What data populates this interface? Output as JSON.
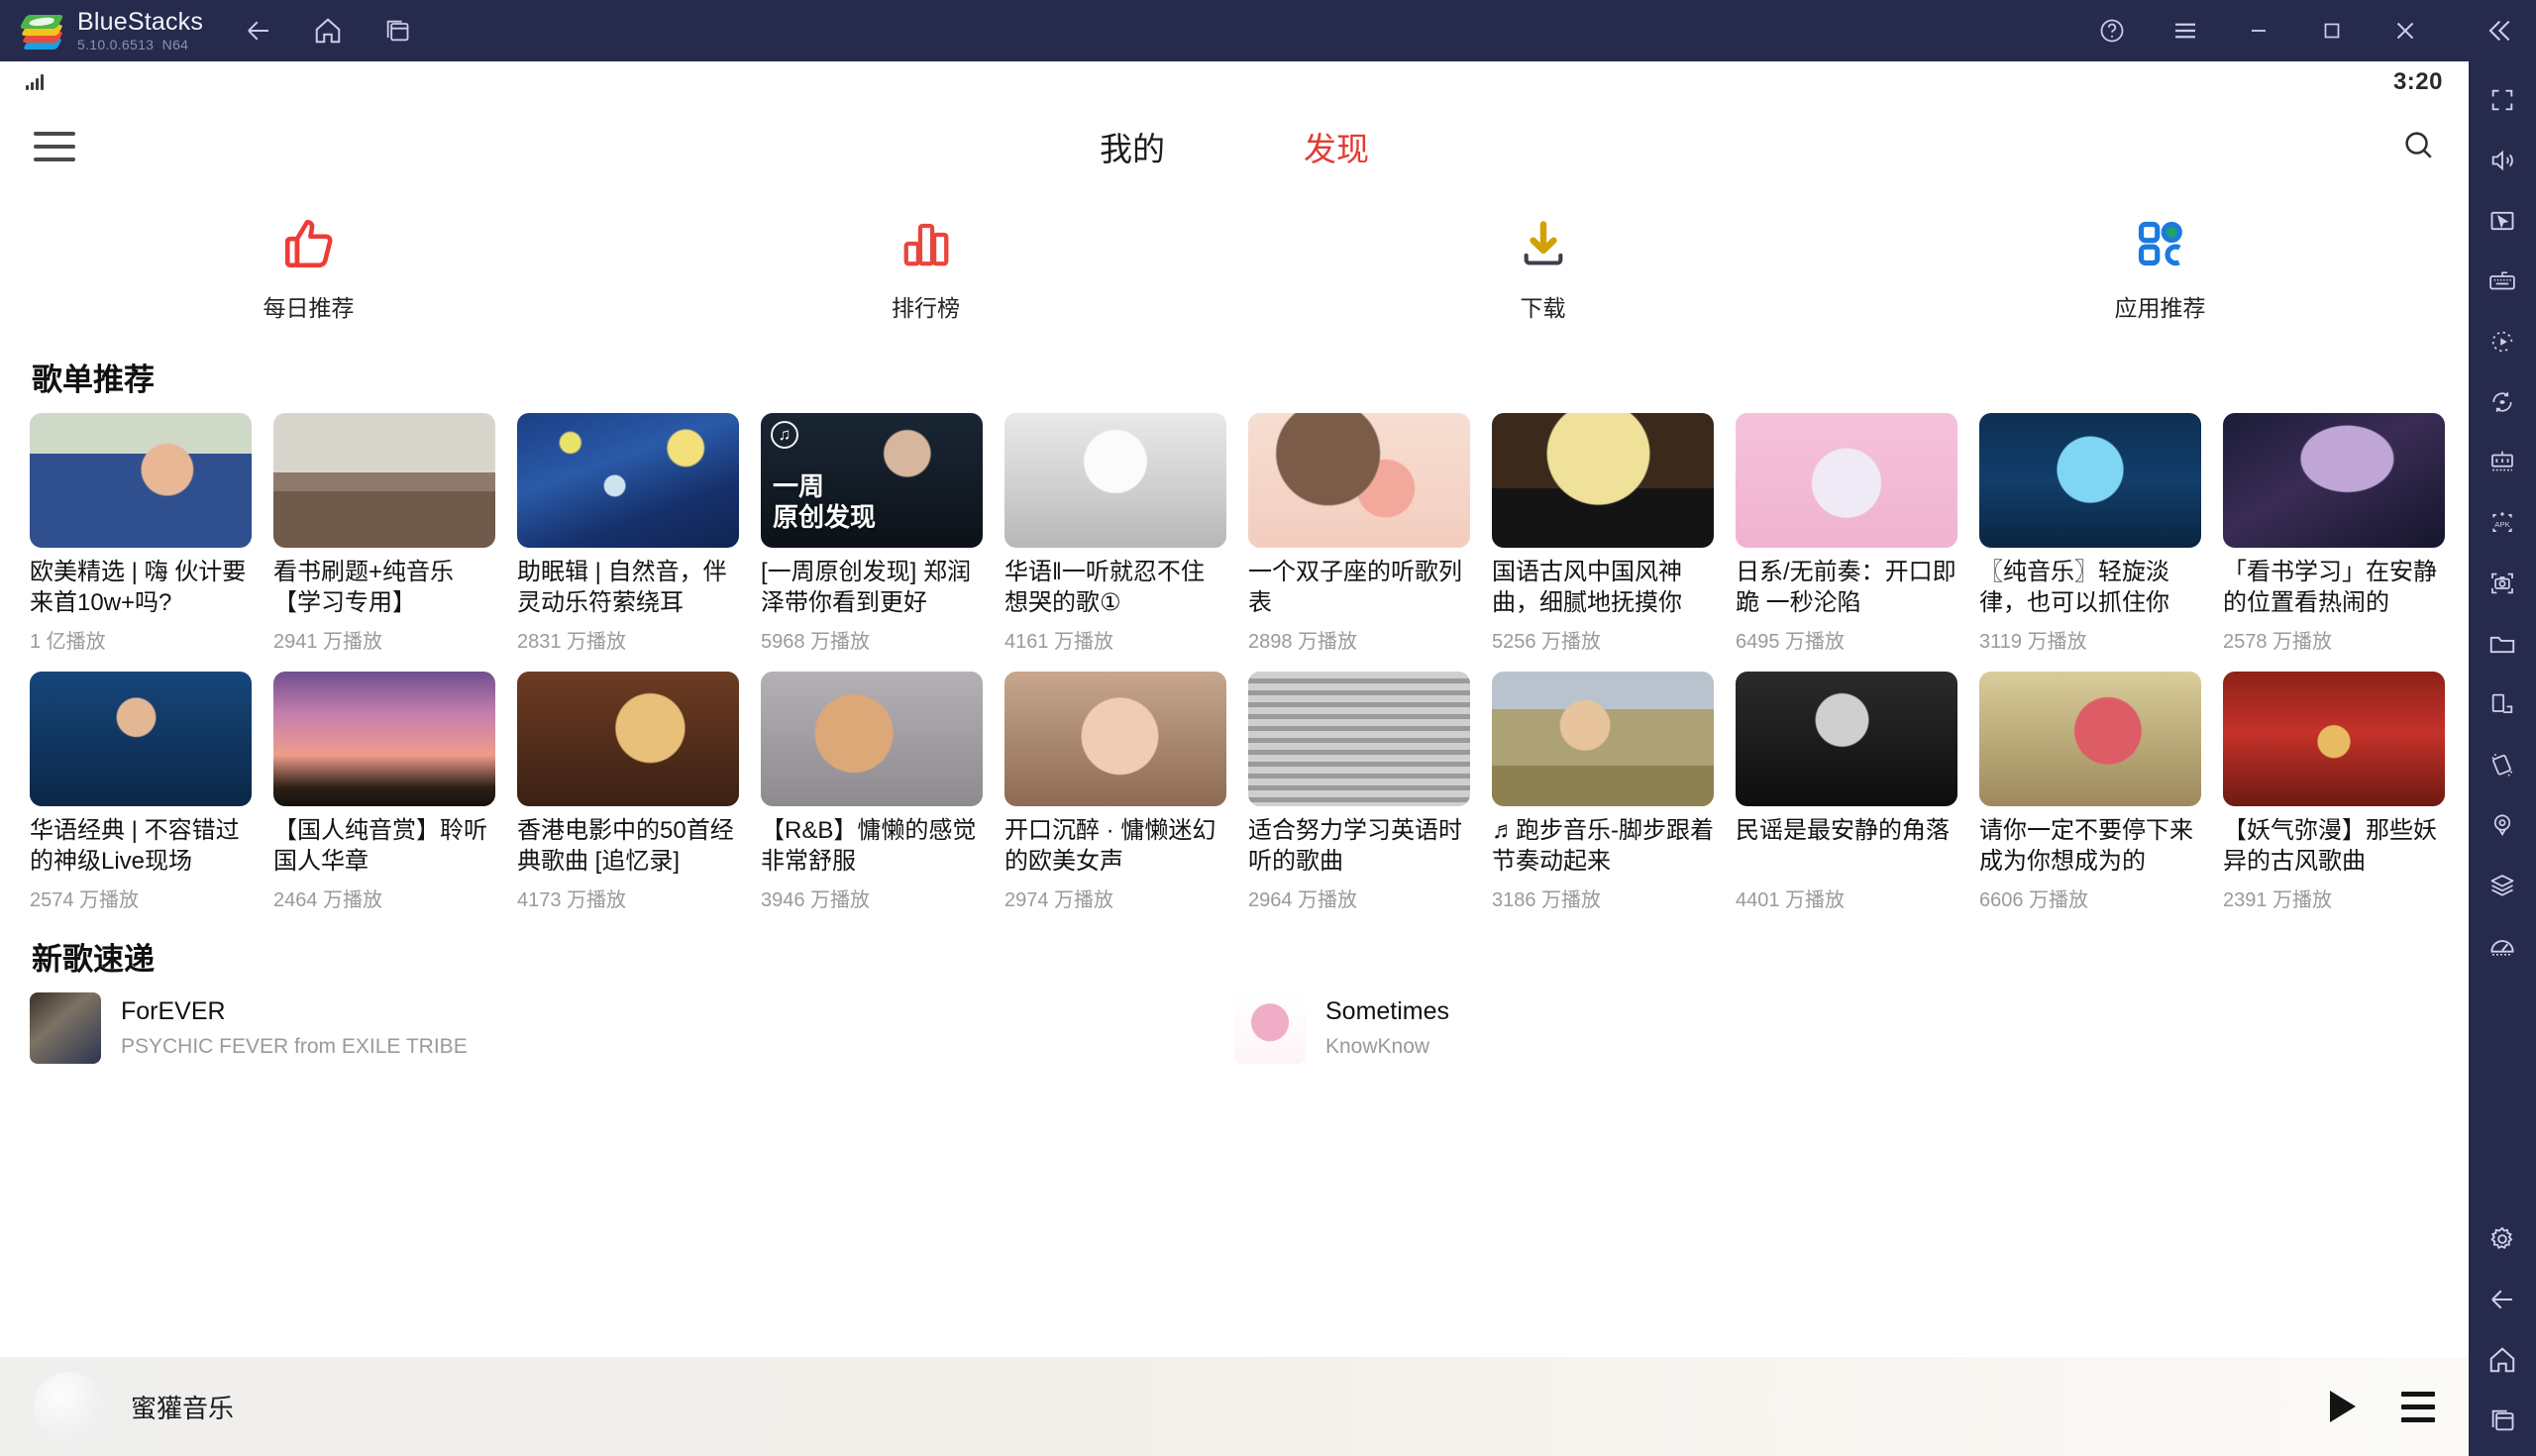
{
  "titlebar": {
    "app_name": "BlueStacks",
    "version": "5.10.0.6513",
    "build": "N64",
    "nav": [
      {
        "name": "back-icon"
      },
      {
        "name": "home-icon"
      },
      {
        "name": "multi-instance-icon"
      }
    ],
    "window_controls": [
      {
        "name": "help-icon"
      },
      {
        "name": "menu-icon"
      },
      {
        "name": "minimize-icon"
      },
      {
        "name": "maximize-icon"
      },
      {
        "name": "close-icon"
      }
    ],
    "collapse": {
      "name": "collapse-sidebar-icon"
    }
  },
  "statusbar": {
    "signal_icon": "signal-bars-icon",
    "time": "3:20"
  },
  "app_header": {
    "menu_icon": "hamburger-menu-icon",
    "search_icon": "search-icon",
    "tabs": [
      {
        "label": "我的",
        "active": false
      },
      {
        "label": "发现",
        "active": true
      }
    ]
  },
  "categories": [
    {
      "label": "每日推荐",
      "icon": "thumbs-up-icon",
      "color": "#ef3b35"
    },
    {
      "label": "排行榜",
      "icon": "ranking-chart-icon",
      "color": "#e8453c"
    },
    {
      "label": "下载",
      "icon": "download-icon",
      "color": "#3b3f4e"
    },
    {
      "label": "应用推荐",
      "icon": "apps-grid-icon",
      "color": "#1a7ae0"
    }
  ],
  "sections": {
    "playlists_title": "歌单推荐",
    "newsongs_title": "新歌速递"
  },
  "playlists_row1": [
    {
      "title": "欧美精选 | 嗨 伙计要来首10w+吗?",
      "plays": "1 亿播放",
      "art": "man-hand-to-ear-blue-suit"
    },
    {
      "title": "看书刷题+纯音乐【学习专用】",
      "plays": "2941 万播放",
      "art": "empty-classroom-desks"
    },
    {
      "title": "助眠辑 | 自然音，伴灵动乐符萦绕耳",
      "plays": "2831 万播放",
      "art": "starry-night-painting"
    },
    {
      "title": "[一周原创发现] 郑润泽带你看到更好",
      "plays": "5968 万播放",
      "art": "man-sunglasses-dark",
      "overlay": "一周\n原创发现",
      "badge": "netease-logo"
    },
    {
      "title": "华语‖一听就忍不住想哭的歌①",
      "plays": "4161 万播放",
      "art": "grayscale-anime-girl-sketch"
    },
    {
      "title": "一个双子座的听歌列表",
      "plays": "2898 万播放",
      "art": "anime-blushing-face-closeup"
    },
    {
      "title": "国语古风中国风神曲，细腻地抚摸你",
      "plays": "5256 万播放",
      "art": "moon-silhouette-warrior"
    },
    {
      "title": "日系/无前奏：开口即跪 一秒沦陷",
      "plays": "6495 万播放",
      "art": "white-hair-anime-girl-pink"
    },
    {
      "title": "〖纯音乐〗轻旋淡律，也可以抓住你",
      "plays": "3119 万播放",
      "art": "blue-underwater-room-fish"
    },
    {
      "title": "「看书学习」在安静的位置看热闹的",
      "plays": "2578 万播放",
      "art": "milky-way-railway-crossing"
    }
  ],
  "playlists_row2": [
    {
      "title": "华语经典 | 不容错过的神级Live现场",
      "plays": "2574 万播放",
      "art": "singer-live-stage-blue"
    },
    {
      "title": "【国人纯音赏】聆听国人华章",
      "plays": "2464 万播放",
      "art": "pink-purple-sunset-sky"
    },
    {
      "title": "香港电影中的50首经典歌曲 [追忆录]",
      "plays": "4173 万播放",
      "art": "hk-movie-couple-warm"
    },
    {
      "title": "【R&B】慵懒的感觉非常舒服",
      "plays": "3946 万播放",
      "art": "charlie-brown-sleeping"
    },
    {
      "title": "开口沉醉 · 慵懒迷幻的欧美女声",
      "plays": "2974 万播放",
      "art": "girl-flower-crown-portrait"
    },
    {
      "title": "适合努力学习英语时听的歌曲",
      "plays": "2964 万播放",
      "art": "bw-girl-guitar-bench"
    },
    {
      "title": "♬跑步音乐-脚步跟着节奏动起来",
      "plays": "3186 万播放",
      "art": "woman-running-field"
    },
    {
      "title": "民谣是最安静的角落",
      "plays": "4401 万播放",
      "art": "bw-woman-singing-crowd"
    },
    {
      "title": "请你一定不要停下来 成为你想成为的",
      "plays": "6606 万播放",
      "art": "ghibli-girl-studying-desk"
    },
    {
      "title": "【妖气弥漫】那些妖异的古风歌曲",
      "plays": "2391 万播放",
      "art": "red-chinese-bridal-robe"
    }
  ],
  "new_songs": [
    {
      "name": "ForEVER",
      "artist": "PSYCHIC FEVER from EXILE TRIBE",
      "cover": "forever-album-dark"
    },
    {
      "name": "Sometimes",
      "artist": "KnowKnow",
      "cover": "sometimes-pink-white"
    }
  ],
  "player": {
    "now_playing": "蜜獾音乐",
    "play_icon": "play-icon",
    "queue_icon": "playlist-queue-icon",
    "avatar": "album-avatar"
  },
  "sidebar_icons": [
    {
      "name": "fullscreen-icon"
    },
    {
      "name": "volume-icon"
    },
    {
      "name": "pointer-cursor-icon"
    },
    {
      "name": "keyboard-controls-icon"
    },
    {
      "name": "macro-record-icon"
    },
    {
      "name": "rotate-screen-icon"
    },
    {
      "name": "multi-instance-manager-icon"
    },
    {
      "name": "install-apk-icon"
    },
    {
      "name": "screenshot-icon"
    },
    {
      "name": "media-folder-icon"
    },
    {
      "name": "split-screen-icon"
    },
    {
      "name": "shake-tilt-icon"
    },
    {
      "name": "location-icon"
    },
    {
      "name": "layers-icon"
    },
    {
      "name": "performance-meter-icon"
    }
  ],
  "sidebar_bottom_icons": [
    {
      "name": "settings-gear-icon"
    },
    {
      "name": "back-icon"
    },
    {
      "name": "home-icon"
    },
    {
      "name": "recents-icon"
    }
  ],
  "colors": {
    "chrome": "#262b4d",
    "accent_red": "#e23b33",
    "app_bg": "#ffffff"
  }
}
